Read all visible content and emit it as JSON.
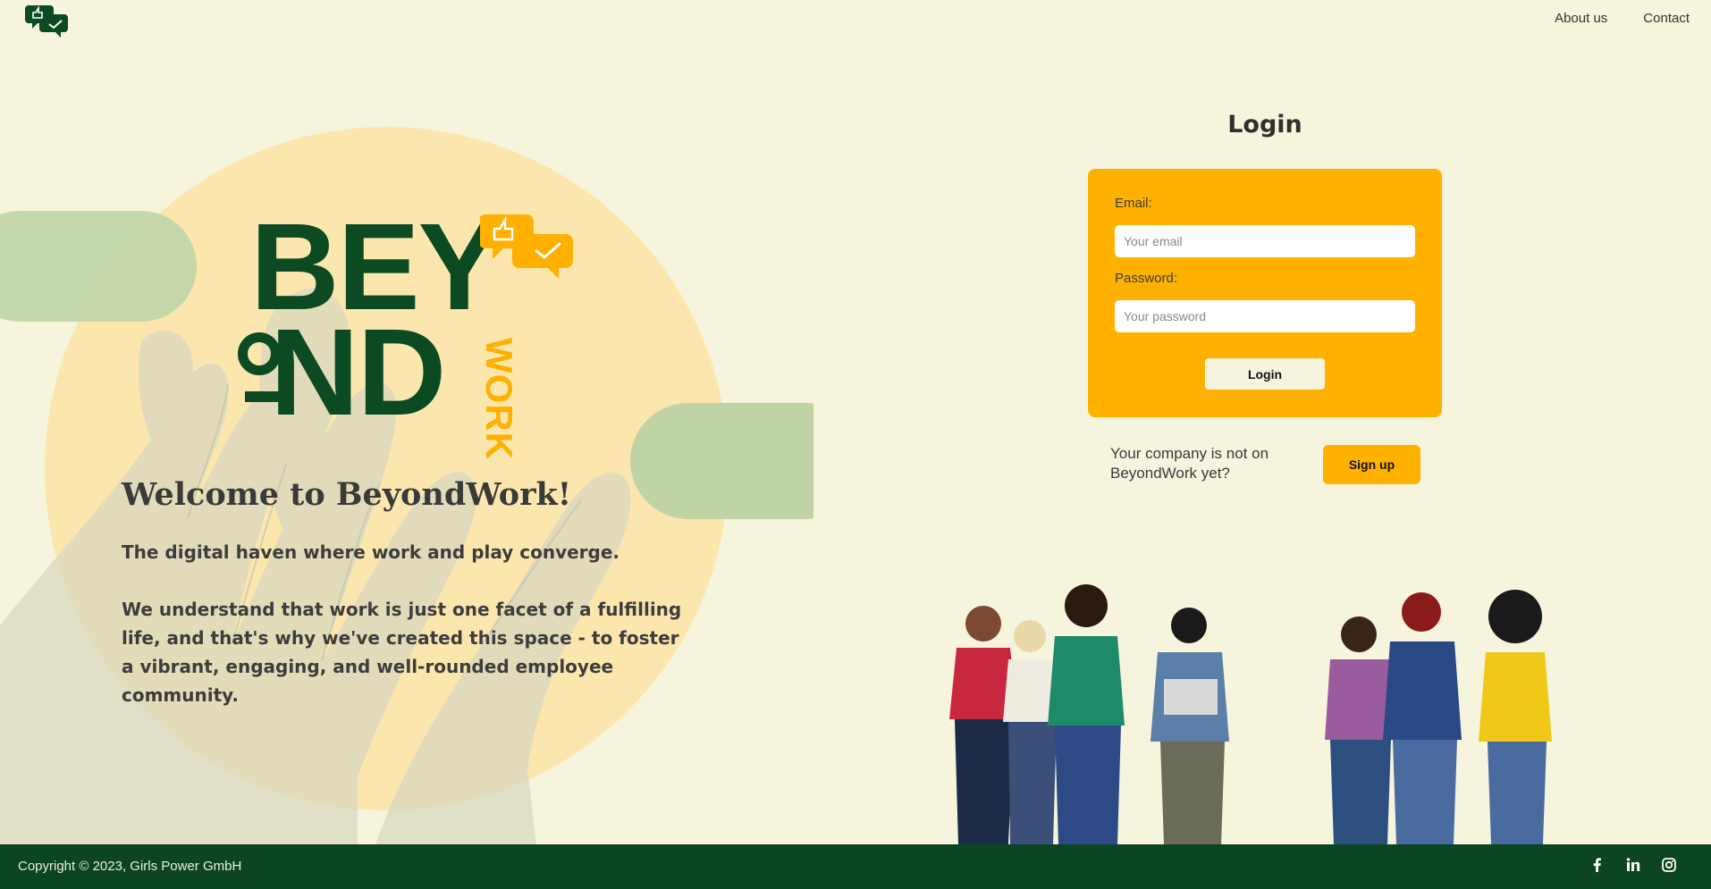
{
  "header": {
    "nav": [
      {
        "label": "About us"
      },
      {
        "label": "Contact"
      }
    ]
  },
  "hero": {
    "logo_line1": "BEY",
    "logo_line2": "ND",
    "logo_side": "WORK",
    "welcome": "Welcome to BeyondWork!",
    "tagline": "The digital haven where work and play converge.",
    "description": "We understand that work is just one facet of a fulfilling life, and that's why we've created this space - to foster a vibrant, engaging, and well-rounded employee community."
  },
  "login": {
    "title": "Login",
    "email_label": "Email:",
    "email_placeholder": "Your email",
    "password_label": "Password:",
    "password_placeholder": "Your password",
    "button": "Login"
  },
  "signup": {
    "prompt": "Your company is not on BeyondWork yet?",
    "button": "Sign up"
  },
  "footer": {
    "copyright": "Copyright © 2023, Girls Power GmbH",
    "social_icons": [
      "facebook-icon",
      "linkedin-icon",
      "instagram-icon"
    ]
  },
  "colors": {
    "background": "#f6f4dc",
    "brand_green": "#0c4a24",
    "accent_yellow": "#ffb100",
    "footer": "#0c4523"
  }
}
